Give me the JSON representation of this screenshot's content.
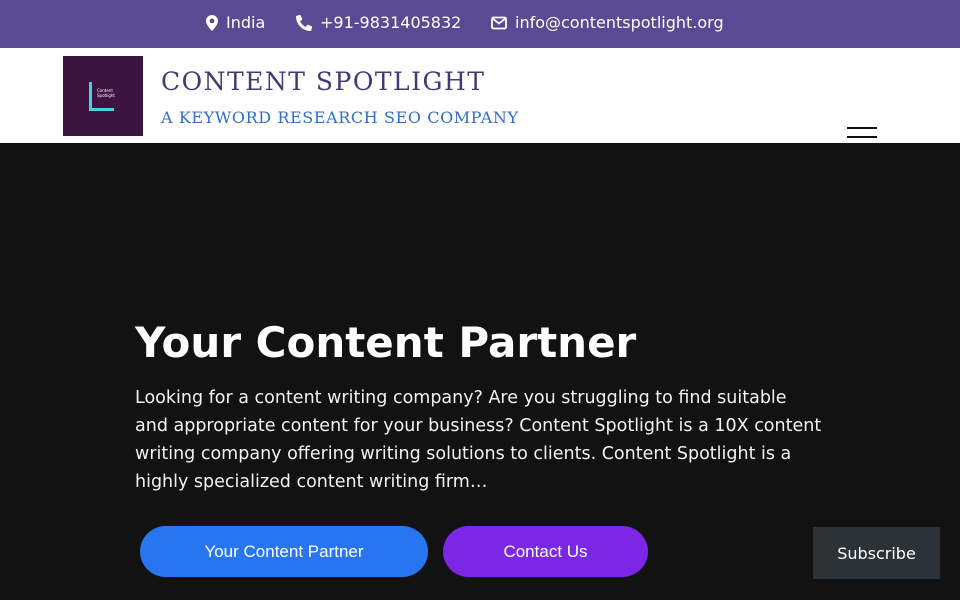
{
  "topbar": {
    "location": "India",
    "phone": "+91-9831405832",
    "email": "info@contentspotlight.org"
  },
  "header": {
    "logo_text_line1": "Content",
    "logo_text_line2": "Spotlight",
    "title": "CONTENT SPOTLIGHT",
    "tagline": "A KEYWORD RESEARCH SEO COMPANY"
  },
  "hero": {
    "title": "Your Content Partner",
    "text": "Looking for a content writing company? Are you struggling to find suitable and appropriate content for your business? Content Spotlight is a 10X content writing company offering writing solutions to clients. Content Spotlight is a highly specialized content writing firm…",
    "buttons": {
      "partner_label": "Your Content Partner",
      "contact_label": "Contact Us"
    }
  },
  "subscribe_label": "Subscribe",
  "icons": {
    "location": "map-marker-icon",
    "phone": "phone-icon",
    "email": "envelope-icon",
    "menu": "hamburger-menu-icon"
  },
  "colors": {
    "topbar": "#5a4a93",
    "brand_title": "#3f3a78",
    "tagline": "#2f6fc9",
    "partner_button": "#2775f0",
    "contact_button": "#7d27e6",
    "subscribe_button": "#2c3238"
  }
}
